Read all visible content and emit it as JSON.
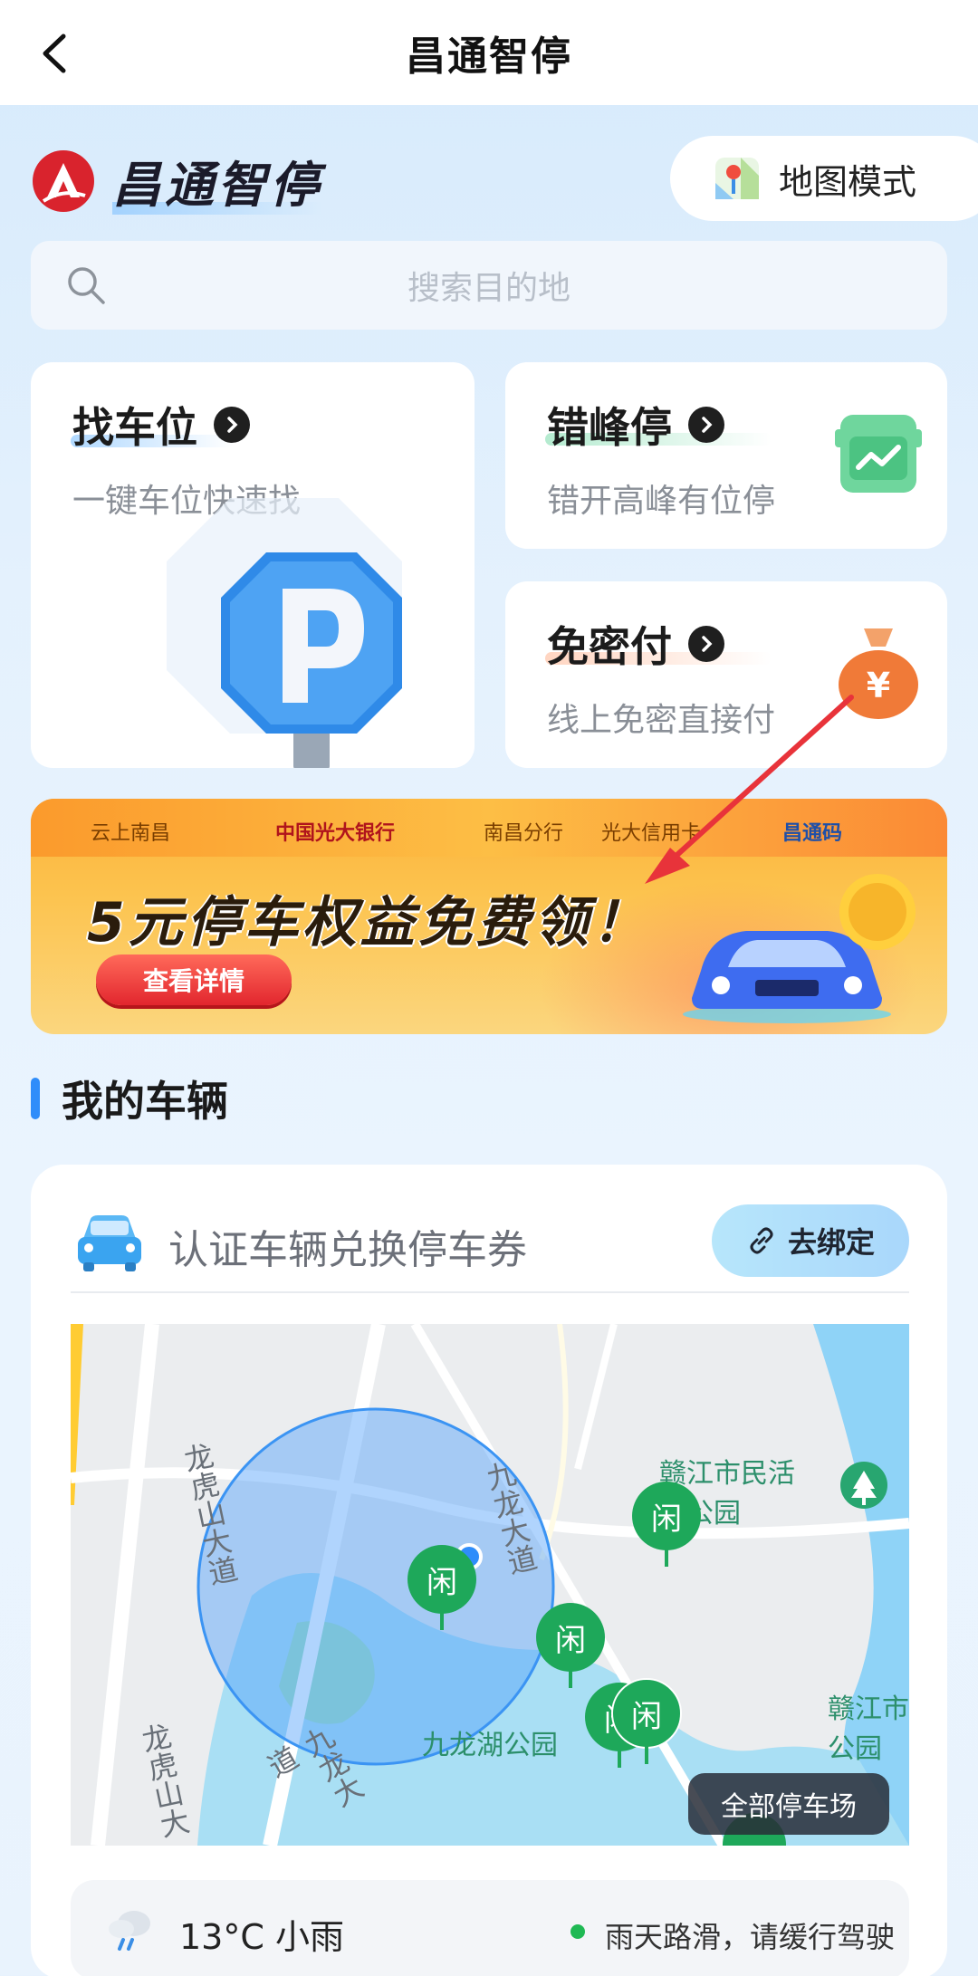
{
  "nav": {
    "title": "昌通智停"
  },
  "brand": {
    "name": "昌通智停"
  },
  "map_mode": {
    "label": "地图模式"
  },
  "search": {
    "placeholder": "搜索目的地"
  },
  "cards": {
    "find": {
      "title": "找车位",
      "subtitle": "一键车位快速找"
    },
    "peak": {
      "title": "错峰停",
      "subtitle": "错开高峰有位停"
    },
    "pay": {
      "title": "免密付",
      "subtitle": "线上免密直接付"
    }
  },
  "banner": {
    "sponsors": [
      "云上南昌",
      "中国光大银行",
      "南昌分行",
      "光大信用卡",
      "昌通码"
    ],
    "headline": "5元停车权益免费领！",
    "button": "查看详情"
  },
  "my_vehicles": {
    "section_title": "我的车辆",
    "prompt": "认证车辆兑换停车券",
    "bind_button": "去绑定"
  },
  "map": {
    "roads": [
      "龙虎山大道",
      "九龙大道",
      "龙虎山大",
      "九龙大道"
    ],
    "places": [
      "赣江市民活力公园",
      "九龙湖公园",
      "赣江市公园"
    ],
    "marker_label": "闲",
    "all_parking_button": "全部停车场"
  },
  "weather": {
    "temp": "13°C 小雨",
    "tip": "雨天路滑，请缓行驾驶"
  },
  "colors": {
    "accent": "#2f8dfa",
    "banner": "#fbb13a",
    "marker": "#1ea85a",
    "status_dot": "#1fb954"
  }
}
